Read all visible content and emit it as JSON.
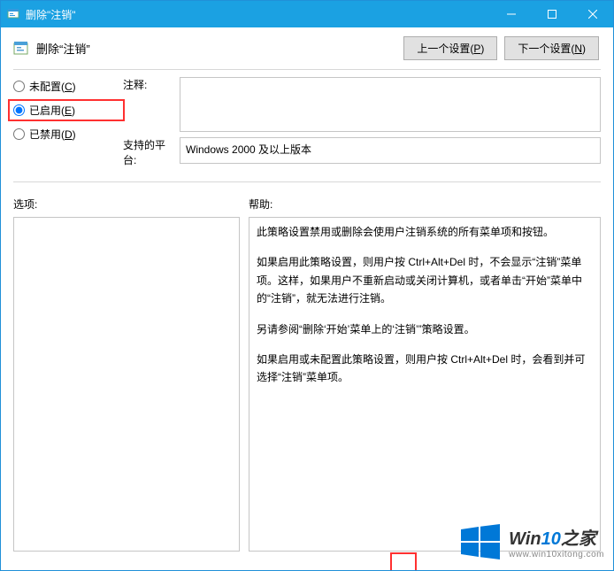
{
  "window": {
    "title": "删除\"注销\""
  },
  "header": {
    "policy_name": "删除“注销”",
    "prev_label_pre": "上一个设置(",
    "prev_key": "P",
    "prev_label_post": ")",
    "next_label_pre": "下一个设置(",
    "next_key": "N",
    "next_label_post": ")"
  },
  "radios": {
    "not_configured_pre": "未配置(",
    "not_configured_key": "C",
    "not_configured_post": ")",
    "enabled_pre": "已启用(",
    "enabled_key": "E",
    "enabled_post": ")",
    "disabled_pre": "已禁用(",
    "disabled_key": "D",
    "disabled_post": ")",
    "selected": "enabled"
  },
  "labels": {
    "comment": "注释:",
    "platform": "支持的平台:",
    "options": "选项:",
    "help": "帮助:"
  },
  "comment_text": "",
  "platform_text": "Windows 2000 及以上版本",
  "help_paragraphs": [
    "此策略设置禁用或删除会使用户注销系统的所有菜单项和按钮。",
    "如果启用此策略设置，则用户按 Ctrl+Alt+Del 时，不会显示“注销”菜单项。这样，如果用户不重新启动或关闭计算机，或者单击“开始”菜单中的“注销”，就无法进行注销。",
    "另请参阅“删除‘开始’菜单上的‘注销’”策略设置。",
    "如果启用或未配置此策略设置，则用户按 Ctrl+Alt+Del 时，会看到并可选择“注销”菜单项。"
  ],
  "watermark": {
    "brand_pre": "Win",
    "brand_blue": "10",
    "brand_post": "之家",
    "url": "www.win10xitong.com"
  }
}
